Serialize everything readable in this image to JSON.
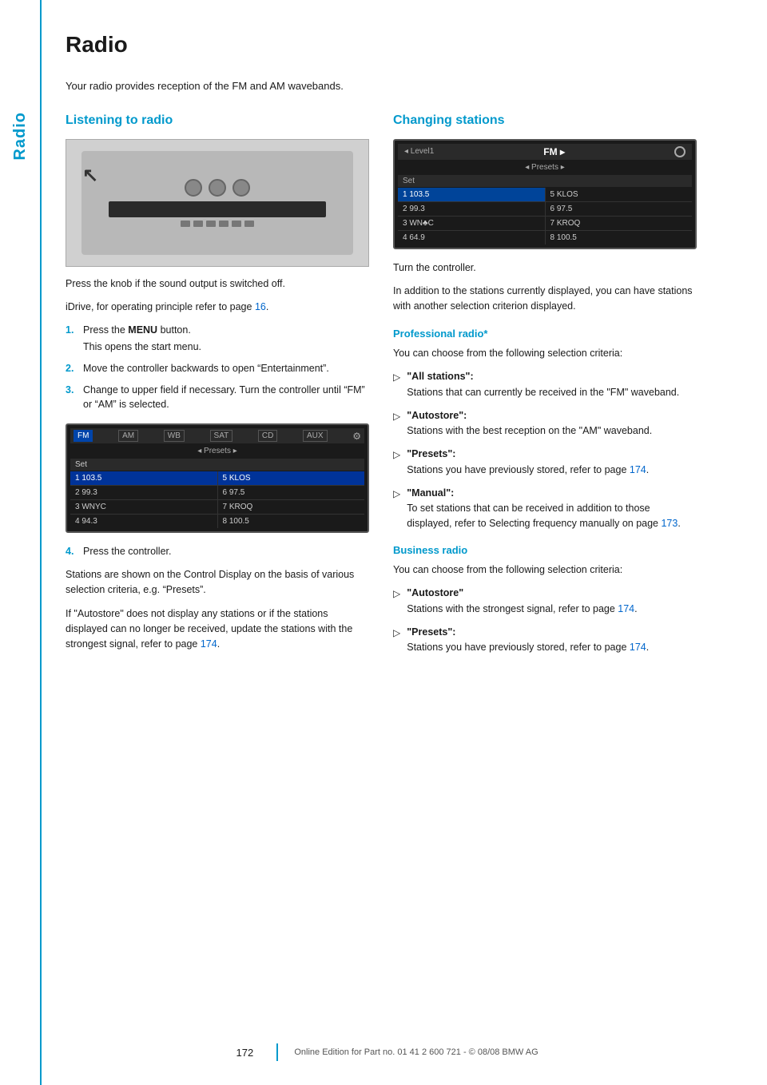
{
  "page": {
    "title": "Radio",
    "intro": "Your radio provides reception of the FM and AM wavebands.",
    "sidebar_label": "Radio"
  },
  "left_column": {
    "section_title": "Listening to radio",
    "body1": "Press the knob if the sound output is switched off.",
    "body2": "iDrive, for operating principle refer to page 16.",
    "numbered_steps": [
      {
        "num": "1.",
        "main": "Press the MENU button.",
        "sub": "This opens the start menu."
      },
      {
        "num": "2.",
        "main": "Move the controller backwards to open “Entertainment”.",
        "sub": ""
      },
      {
        "num": "3.",
        "main": "Change to upper field if necessary. Turn the controller until “FM” or “AM” is selected.",
        "sub": ""
      }
    ],
    "step4": {
      "num": "4.",
      "text": "Press the controller."
    },
    "body3": "Stations are shown on the Control Display on the basis of various selection criteria, e.g. “Presets”.",
    "body4": "If “Autostore” does not display any stations or if the stations displayed can no longer be received, update the stations with the strongest signal, refer to page 174.",
    "body4_link": "174",
    "screen1": {
      "tabs": [
        "FM",
        "AM",
        "WB",
        "SAT",
        "CD",
        "AUX"
      ],
      "active_tab": "FM",
      "presets": "‹ Presets ›",
      "set_label": "Set",
      "stations": [
        {
          "pos": "1",
          "freq": "103.5",
          "side": "5 KLOS"
        },
        {
          "pos": "2",
          "freq": "99.3",
          "side": "6 97.5"
        },
        {
          "pos": "3",
          "freq": "WNYC",
          "side": "7 KROQ"
        },
        {
          "pos": "4",
          "freq": "94.3",
          "side": "8 100.5"
        }
      ]
    }
  },
  "right_column": {
    "section_title": "Changing stations",
    "body1": "Turn the controller.",
    "body2": "In addition to the stations currently displayed, you can have stations with another selection criterion displayed.",
    "screen2": {
      "top_label": "FM",
      "presets": "‹ Presets ›",
      "set_label": "Set",
      "stations": [
        {
          "pos": "1",
          "freq": "103.5",
          "side": "5 KLOS"
        },
        {
          "pos": "2",
          "freq": "99.3",
          "side": "6 97.5"
        },
        {
          "pos": "3",
          "freq": "WN♣C",
          "side": "7 KROQ"
        },
        {
          "pos": "4",
          "freq": "64.9",
          "side": "8 100.5"
        }
      ]
    },
    "professional_radio": {
      "title": "Professional radio*",
      "intro": "You can choose from the following selection criteria:",
      "items": [
        {
          "title": "\"All stations\":",
          "desc": "Stations that can currently be received in the \"FM\" waveband."
        },
        {
          "title": "\"Autostore\":",
          "desc": "Stations with the best reception on the \"AM\" waveband."
        },
        {
          "title": "\"Presets\":",
          "desc": "Stations you have previously stored, refer to page 174.",
          "link": "174"
        },
        {
          "title": "\"Manual\":",
          "desc": "To set stations that can be received in addition to those displayed, refer to Selecting frequency manually on page 173.",
          "link": "173"
        }
      ]
    },
    "business_radio": {
      "title": "Business radio",
      "intro": "You can choose from the following selection criteria:",
      "items": [
        {
          "title": "\"Autostore\"",
          "desc": "Stations with the strongest signal, refer to page 174.",
          "link": "174"
        },
        {
          "title": "\"Presets\":",
          "desc": "Stations you have previously stored, refer to page 174.",
          "link": "174"
        }
      ]
    }
  },
  "footer": {
    "page_number": "172",
    "text": "Online Edition for Part no. 01 41 2 600 721 - © 08/08 BMW AG"
  }
}
